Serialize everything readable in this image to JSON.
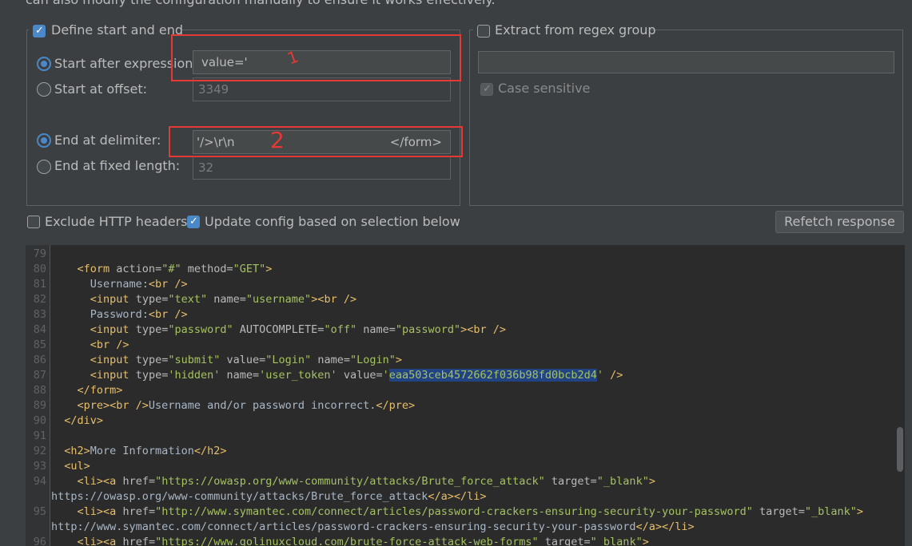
{
  "header_text": "can also modify the configuration manually to ensure it works effectively.",
  "define": {
    "checkbox_label": "Define start and end",
    "start_after_label": "Start after expression:",
    "start_after_value": "value='",
    "start_offset_label": "Start at offset:",
    "start_offset_value": "3349",
    "end_delim_label": "End at delimiter:",
    "end_delim_value": "'/>\\r\\n",
    "end_delim_value_right": "</form>",
    "end_fixed_label": "End at fixed length:",
    "end_fixed_value": "32"
  },
  "regex": {
    "checkbox_label": "Extract from regex group",
    "input_value": "",
    "case_label": "Case sensitive"
  },
  "annotations": {
    "mark1": "1",
    "mark2": "2"
  },
  "options": {
    "exclude_headers_label": "Exclude HTTP headers",
    "update_config_label": "Update config based on selection below",
    "refetch_label": "Refetch response"
  },
  "code": {
    "line_numbers": [
      "79",
      "80",
      "81",
      "82",
      "83",
      "84",
      "85",
      "86",
      "87",
      "88",
      "89",
      "90",
      "91",
      "92",
      "93",
      "94",
      "",
      "95",
      "",
      "96"
    ],
    "token": "eaa503ceb4572662f036b98fd0bcb2d4"
  },
  "colors": {
    "accent": "#4a88c7",
    "annotation_red": "#e53935",
    "tag": "#e8bf6a",
    "value": "#a5c261"
  }
}
